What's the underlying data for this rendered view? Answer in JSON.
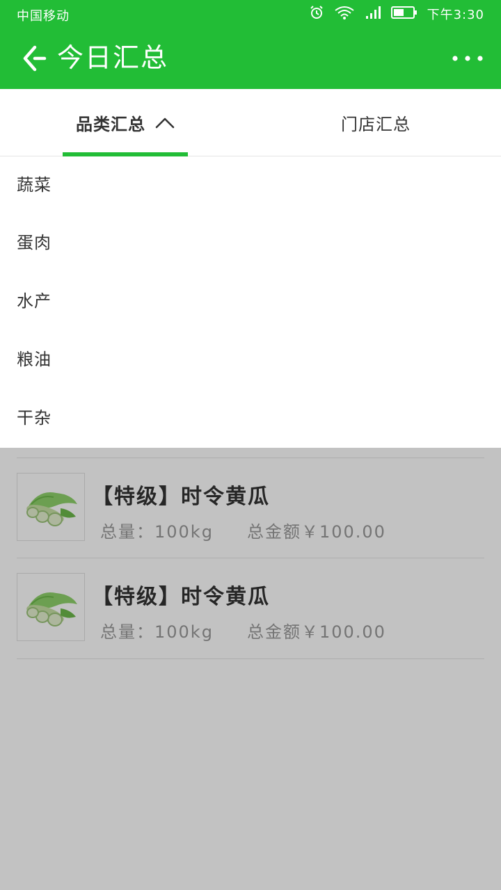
{
  "status_bar": {
    "carrier": "中国移动",
    "time": "下午3:30",
    "icons": [
      "alarm-icon",
      "wifi-icon",
      "signal-icon",
      "battery-icon"
    ]
  },
  "header": {
    "title": "今日汇总",
    "back_icon": "back-arrow-icon",
    "more_icon": "more-dots-icon",
    "background_color": "#22bd36"
  },
  "tabs": [
    {
      "label": "品类汇总",
      "active": true,
      "icon": "chevron-up-icon"
    },
    {
      "label": "门店汇总",
      "active": false
    }
  ],
  "category_dropdown": {
    "items": [
      "蔬菜",
      "蛋肉",
      "水产",
      "粮油",
      "干杂"
    ]
  },
  "products": [
    {
      "name": "【特级】时令黄瓜",
      "quantity_label": "总量：",
      "quantity": "100kg",
      "amount_label": "总金额",
      "amount": "￥100.00",
      "image": "cucumber-image"
    },
    {
      "name": "【特级】时令黄瓜",
      "quantity_label": "总量：",
      "quantity": "100kg",
      "amount_label": "总金额",
      "amount": "￥100.00",
      "image": "cucumber-image"
    }
  ],
  "colors": {
    "accent": "#22bd36",
    "overlay": "rgba(0,0,0,0.24)"
  }
}
